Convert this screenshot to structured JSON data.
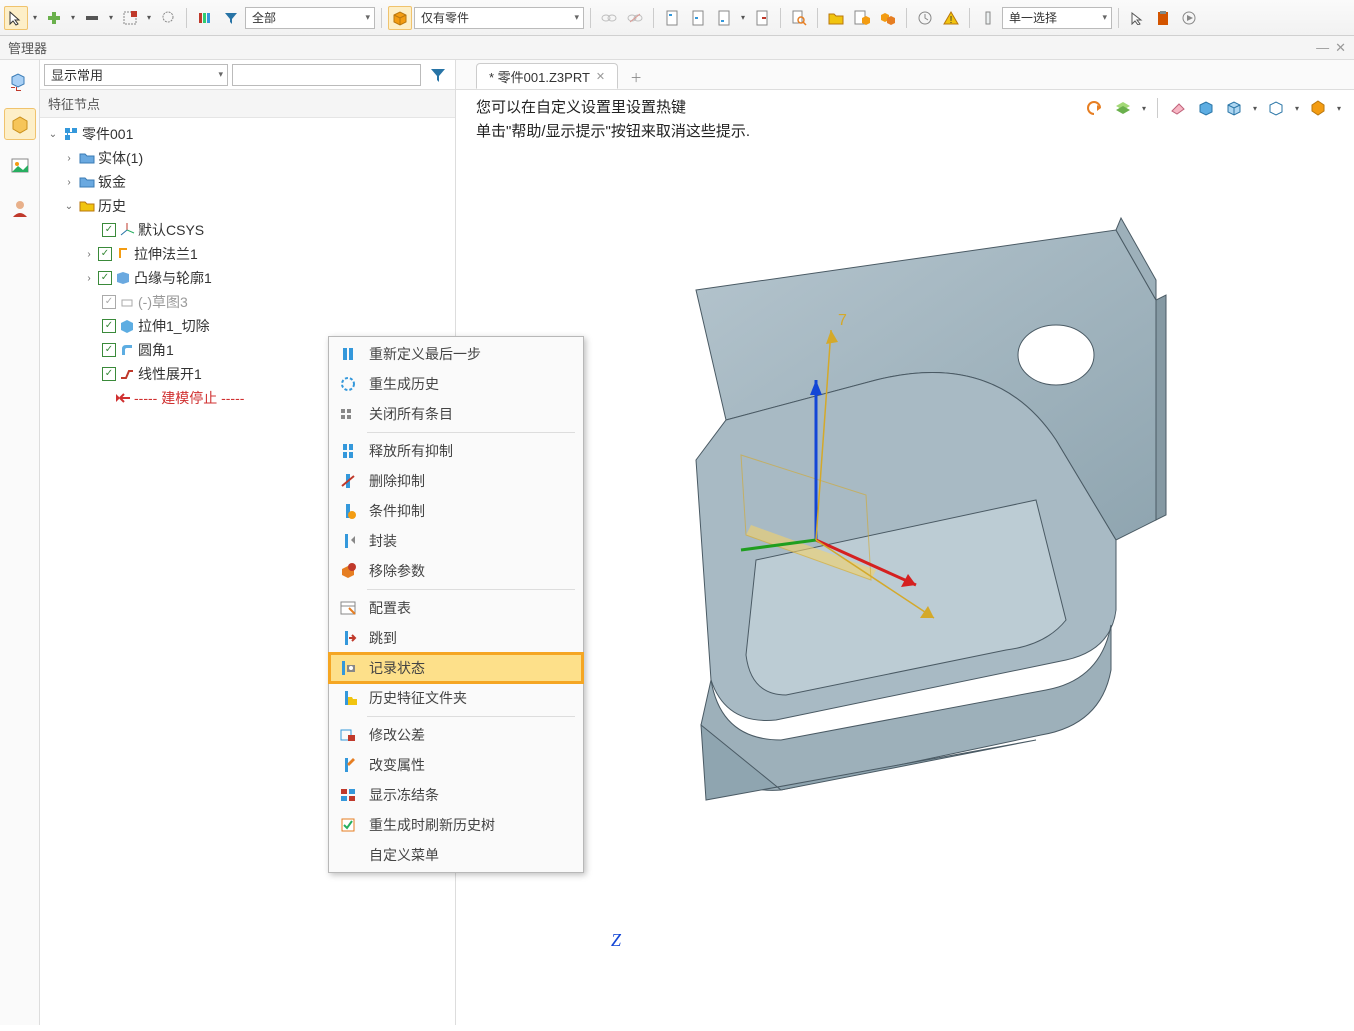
{
  "toolbar": {
    "combo1": "全部",
    "combo2": "仅有零件",
    "combo3": "单一选择"
  },
  "manager": {
    "title": "管理器"
  },
  "sidebar": {
    "display_combo": "显示常用",
    "section_header": "特征节点",
    "tree": {
      "root": "零件001",
      "solid": "实体(1)",
      "sheetmetal": "钣金",
      "history": "历史",
      "csys": "默认CSYS",
      "flange": "拉伸法兰1",
      "contour": "凸缘与轮廓1",
      "sketch": "(-)草图3",
      "cut": "拉伸1_切除",
      "fillet": "圆角1",
      "unfold": "线性展开1",
      "stop": "----- 建模停止 -----"
    }
  },
  "tab": {
    "title": "* 零件001.Z3PRT"
  },
  "hint": {
    "line1": "您可以在自定义设置里设置热键",
    "line2": "单击\"帮助/显示提示\"按钮来取消这些提示."
  },
  "context_menu": {
    "redefine": "重新定义最后一步",
    "regen": "重生成历史",
    "closeall": "关闭所有条目",
    "release": "释放所有抑制",
    "delete_sup": "删除抑制",
    "cond_sup": "条件抑制",
    "encap": "封装",
    "remove_param": "移除参数",
    "config": "配置表",
    "jump": "跳到",
    "record": "记录状态",
    "folder": "历史特征文件夹",
    "tolerance": "修改公差",
    "change_attr": "改变属性",
    "freeze": "显示冻结条",
    "refresh": "重生成时刷新历史树",
    "custom": "自定义菜单"
  },
  "axis": {
    "z": "Z"
  }
}
